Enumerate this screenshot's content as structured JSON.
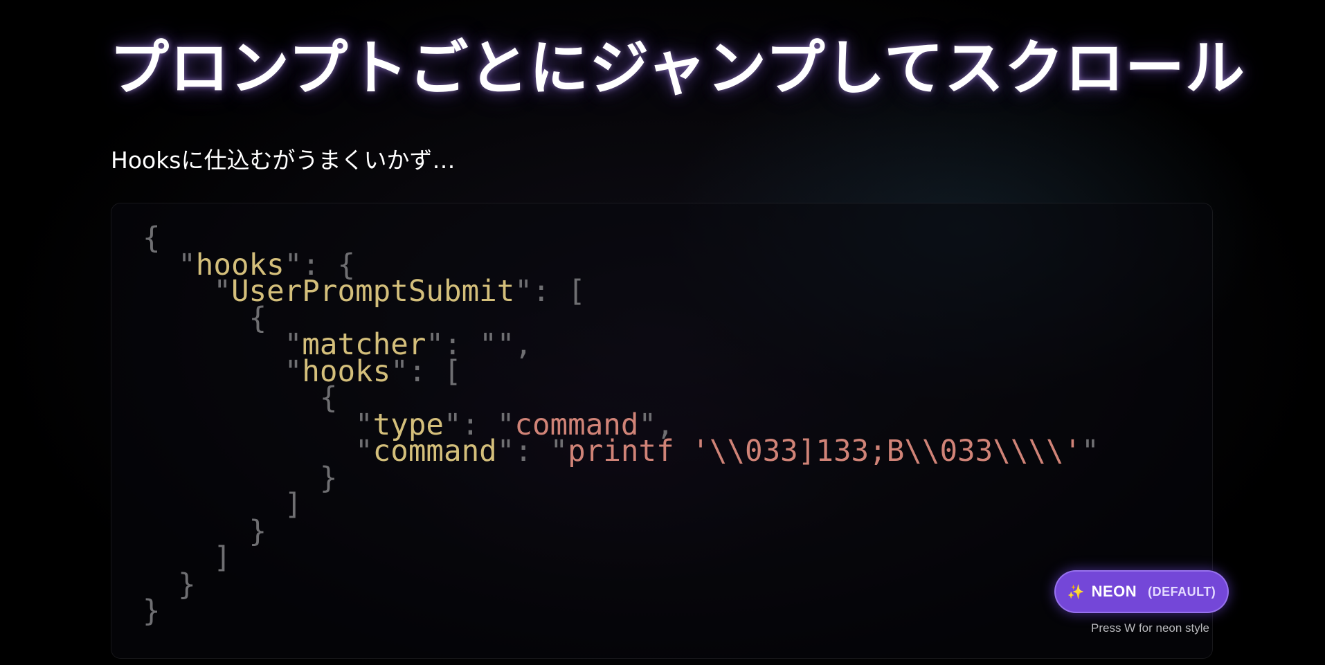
{
  "slide": {
    "title": "プロンプトごとにジャンプしてスクロール",
    "subtitle": "Hooksに仕込むがうまくいかず…"
  },
  "code_block": {
    "lines": [
      [
        {
          "t": "{",
          "c": "punc"
        }
      ],
      [
        {
          "t": "  ",
          "c": "punc"
        },
        {
          "t": "\"",
          "c": "punc"
        },
        {
          "t": "hooks",
          "c": "key"
        },
        {
          "t": "\"",
          "c": "punc"
        },
        {
          "t": ": {",
          "c": "punc"
        }
      ],
      [
        {
          "t": "    ",
          "c": "punc"
        },
        {
          "t": "\"",
          "c": "punc"
        },
        {
          "t": "UserPromptSubmit",
          "c": "key"
        },
        {
          "t": "\"",
          "c": "punc"
        },
        {
          "t": ": [",
          "c": "punc"
        }
      ],
      [
        {
          "t": "      {",
          "c": "punc"
        }
      ],
      [
        {
          "t": "        ",
          "c": "punc"
        },
        {
          "t": "\"",
          "c": "punc"
        },
        {
          "t": "matcher",
          "c": "key"
        },
        {
          "t": "\"",
          "c": "punc"
        },
        {
          "t": ": ",
          "c": "punc"
        },
        {
          "t": "\"\"",
          "c": "punc"
        },
        {
          "t": ",",
          "c": "punc"
        }
      ],
      [
        {
          "t": "        ",
          "c": "punc"
        },
        {
          "t": "\"",
          "c": "punc"
        },
        {
          "t": "hooks",
          "c": "key"
        },
        {
          "t": "\"",
          "c": "punc"
        },
        {
          "t": ": [",
          "c": "punc"
        }
      ],
      [
        {
          "t": "          {",
          "c": "punc"
        }
      ],
      [
        {
          "t": "            ",
          "c": "punc"
        },
        {
          "t": "\"",
          "c": "punc"
        },
        {
          "t": "type",
          "c": "key"
        },
        {
          "t": "\"",
          "c": "punc"
        },
        {
          "t": ": ",
          "c": "punc"
        },
        {
          "t": "\"",
          "c": "punc"
        },
        {
          "t": "command",
          "c": "str"
        },
        {
          "t": "\"",
          "c": "punc"
        },
        {
          "t": ",",
          "c": "punc"
        }
      ],
      [
        {
          "t": "            ",
          "c": "punc"
        },
        {
          "t": "\"",
          "c": "punc"
        },
        {
          "t": "command",
          "c": "key"
        },
        {
          "t": "\"",
          "c": "punc"
        },
        {
          "t": ": ",
          "c": "punc"
        },
        {
          "t": "\"",
          "c": "punc"
        },
        {
          "t": "printf '\\\\033]133;B\\\\033\\\\\\\\'",
          "c": "str"
        },
        {
          "t": "\"",
          "c": "punc"
        }
      ],
      [
        {
          "t": "          }",
          "c": "punc"
        }
      ],
      [
        {
          "t": "        ]",
          "c": "punc"
        }
      ],
      [
        {
          "t": "      }",
          "c": "punc"
        }
      ],
      [
        {
          "t": "    ]",
          "c": "punc"
        }
      ],
      [
        {
          "t": "  }",
          "c": "punc"
        }
      ],
      [
        {
          "t": "}",
          "c": "punc"
        }
      ]
    ]
  },
  "style_switcher": {
    "icon": "sparkles-icon",
    "glyph": "✨",
    "name": "NEON",
    "mode": "(DEFAULT)",
    "hint": "Press W for neon style",
    "accent_color": "#7447d8"
  },
  "colors": {
    "background": "#000000",
    "json_key": "#d4bf7b",
    "json_string": "#d08377",
    "json_punctuation": "#6f6f72"
  }
}
